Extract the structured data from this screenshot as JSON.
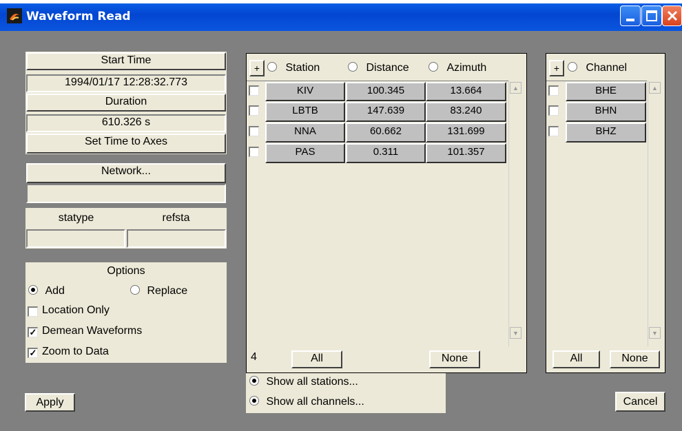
{
  "window": {
    "title": "Waveform Read"
  },
  "time": {
    "start_label": "Start Time",
    "start_value": "1994/01/17 12:28:32.773",
    "duration_label": "Duration",
    "duration_value": "610.326 s",
    "set_time_label": "Set Time to Axes"
  },
  "network": {
    "button_label": "Network...",
    "value": ""
  },
  "filters": {
    "statype_label": "statype",
    "refsta_label": "refsta",
    "statype_value": "",
    "refsta_value": ""
  },
  "options": {
    "title": "Options",
    "add_label": "Add",
    "replace_label": "Replace",
    "location_only_label": "Location Only",
    "demean_label": "Demean Waveforms",
    "zoom_label": "Zoom to Data",
    "add_selected": true,
    "location_only": false,
    "demean": true,
    "zoom": true
  },
  "apply_label": "Apply",
  "cancel_label": "Cancel",
  "stations": {
    "plus_label": "+",
    "sort_station": "Station",
    "sort_distance": "Distance",
    "sort_azimuth": "Azimuth",
    "rows": [
      {
        "name": "KIV",
        "distance": "100.345",
        "azimuth": "13.664"
      },
      {
        "name": "LBTB",
        "distance": "147.639",
        "azimuth": "83.240"
      },
      {
        "name": "NNA",
        "distance": "60.662",
        "azimuth": "131.699"
      },
      {
        "name": "PAS",
        "distance": "0.311",
        "azimuth": "101.357"
      }
    ],
    "count": "4",
    "all_label": "All",
    "none_label": "None"
  },
  "channels": {
    "plus_label": "+",
    "sort_channel": "Channel",
    "rows": [
      "BHE",
      "BHN",
      "BHZ"
    ],
    "all_label": "All",
    "none_label": "None"
  },
  "show_all_stations_label": "Show all stations...",
  "show_all_channels_label": "Show all channels..."
}
